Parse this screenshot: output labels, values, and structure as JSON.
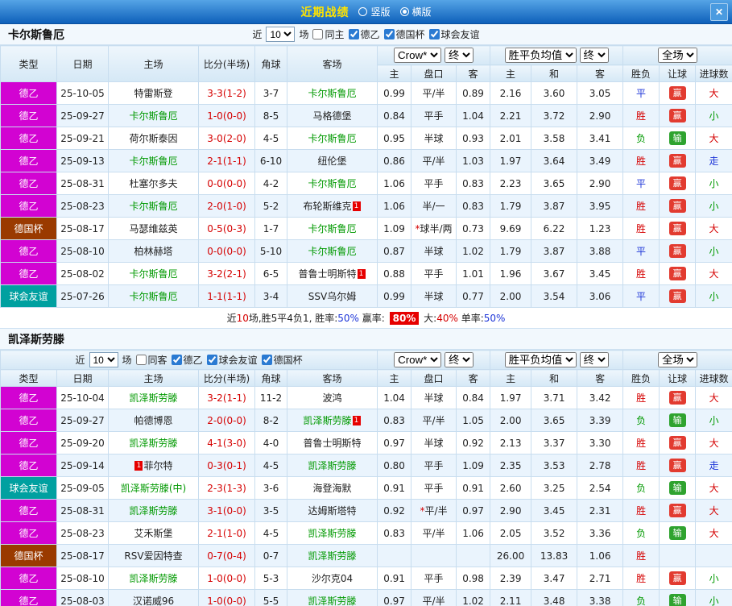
{
  "topbar": {
    "title": "近期战绩",
    "layout_options": [
      {
        "label": "竖版",
        "selected": false
      },
      {
        "label": "横版",
        "selected": true
      }
    ],
    "close_label": "✕"
  },
  "filter_near": "近",
  "filter_games": "场",
  "dropdowns": {
    "count": "10",
    "bookmaker": "Crow*",
    "time": "终",
    "avg": "胜平负均值",
    "scope": "全场"
  },
  "columns": {
    "type": "类型",
    "date": "日期",
    "home": "主场",
    "score": "比分(半场)",
    "corner": "角球",
    "away": "客场",
    "odds_home": "主",
    "odds_line": "盘口",
    "odds_away": "客",
    "eu_home": "主",
    "eu_draw": "和",
    "eu_away": "客",
    "result": "胜负",
    "handicap": "让球",
    "goals": "进球数"
  },
  "sections": [
    {
      "team": "卡尔斯鲁厄",
      "filters": [
        {
          "label": "同主",
          "checked": false
        },
        {
          "label": "德乙",
          "checked": true
        },
        {
          "label": "德国杯",
          "checked": true
        },
        {
          "label": "球会友谊",
          "checked": true
        }
      ],
      "rows": [
        {
          "type": "德乙",
          "date": "25-10-05",
          "home": {
            "name": "特雷斯登"
          },
          "score": "3-3(1-2)",
          "corner": "3-7",
          "away": {
            "name": "卡尔斯鲁厄",
            "featured": true
          },
          "o1": "0.99",
          "line": "平/半",
          "o2": "0.89",
          "w": "2.16",
          "d": "3.60",
          "l": "3.05",
          "res": "平",
          "bet": "赢",
          "goal": "大"
        },
        {
          "type": "德乙",
          "date": "25-09-27",
          "home": {
            "name": "卡尔斯鲁厄",
            "featured": true
          },
          "score": "1-0(0-0)",
          "corner": "8-5",
          "away": {
            "name": "马格德堡"
          },
          "o1": "0.84",
          "line": "平手",
          "o2": "1.04",
          "w": "2.21",
          "d": "3.72",
          "l": "2.90",
          "res": "胜",
          "bet": "赢",
          "goal": "小"
        },
        {
          "type": "德乙",
          "date": "25-09-21",
          "home": {
            "name": "荷尔斯泰因"
          },
          "score": "3-0(2-0)",
          "corner": "4-5",
          "away": {
            "name": "卡尔斯鲁厄",
            "featured": true
          },
          "o1": "0.95",
          "line": "半球",
          "o2": "0.93",
          "w": "2.01",
          "d": "3.58",
          "l": "3.41",
          "res": "负",
          "bet": "输",
          "goal": "大"
        },
        {
          "type": "德乙",
          "date": "25-09-13",
          "home": {
            "name": "卡尔斯鲁厄",
            "featured": true
          },
          "score": "2-1(1-1)",
          "corner": "6-10",
          "away": {
            "name": "纽伦堡"
          },
          "o1": "0.86",
          "line": "平/半",
          "o2": "1.03",
          "w": "1.97",
          "d": "3.64",
          "l": "3.49",
          "res": "胜",
          "bet": "赢",
          "goal": "走"
        },
        {
          "type": "德乙",
          "date": "25-08-31",
          "home": {
            "name": "杜塞尔多夫"
          },
          "score": "0-0(0-0)",
          "corner": "4-2",
          "away": {
            "name": "卡尔斯鲁厄",
            "featured": true
          },
          "o1": "1.06",
          "line": "平手",
          "o2": "0.83",
          "w": "2.23",
          "d": "3.65",
          "l": "2.90",
          "res": "平",
          "bet": "赢",
          "goal": "小"
        },
        {
          "type": "德乙",
          "date": "25-08-23",
          "home": {
            "name": "卡尔斯鲁厄",
            "featured": true
          },
          "score": "2-0(1-0)",
          "corner": "5-2",
          "away": {
            "name": "布轮斯维克",
            "badge": "1"
          },
          "o1": "1.06",
          "line": "半/一",
          "o2": "0.83",
          "w": "1.79",
          "d": "3.87",
          "l": "3.95",
          "res": "胜",
          "bet": "赢",
          "goal": "小"
        },
        {
          "type": "德国杯",
          "date": "25-08-17",
          "home": {
            "name": "马瑟维兹英"
          },
          "score": "0-5(0-3)",
          "corner": "1-7",
          "away": {
            "name": "卡尔斯鲁厄",
            "featured": true
          },
          "o1": "1.09",
          "line": "*球半/两",
          "o2": "0.73",
          "w": "9.69",
          "d": "6.22",
          "l": "1.23",
          "res": "胜",
          "bet": "赢",
          "goal": "大"
        },
        {
          "type": "德乙",
          "date": "25-08-10",
          "home": {
            "name": "柏林赫塔"
          },
          "score": "0-0(0-0)",
          "corner": "5-10",
          "away": {
            "name": "卡尔斯鲁厄",
            "featured": true
          },
          "o1": "0.87",
          "line": "半球",
          "o2": "1.02",
          "w": "1.79",
          "d": "3.87",
          "l": "3.88",
          "res": "平",
          "bet": "赢",
          "goal": "小"
        },
        {
          "type": "德乙",
          "date": "25-08-02",
          "home": {
            "name": "卡尔斯鲁厄",
            "featured": true
          },
          "score": "3-2(2-1)",
          "corner": "6-5",
          "away": {
            "name": "普鲁士明斯特",
            "badge": "1"
          },
          "o1": "0.88",
          "line": "平手",
          "o2": "1.01",
          "w": "1.96",
          "d": "3.67",
          "l": "3.45",
          "res": "胜",
          "bet": "赢",
          "goal": "大"
        },
        {
          "type": "球会友谊",
          "date": "25-07-26",
          "home": {
            "name": "卡尔斯鲁厄",
            "featured": true
          },
          "score": "1-1(1-1)",
          "corner": "3-4",
          "away": {
            "name": "SSV乌尔姆"
          },
          "o1": "0.99",
          "line": "半球",
          "o2": "0.77",
          "w": "2.00",
          "d": "3.54",
          "l": "3.06",
          "res": "平",
          "bet": "赢",
          "goal": "小"
        }
      ],
      "summary_parts": [
        {
          "t": "近",
          "s": ""
        },
        {
          "t": "10",
          "s": "red"
        },
        {
          "t": "场,胜5平4负1, 胜率:",
          "s": ""
        },
        {
          "t": "50%",
          "s": "blue"
        },
        {
          "t": " 赢率: ",
          "s": ""
        },
        {
          "t": "80%",
          "s": "badge"
        },
        {
          "t": " 大:",
          "s": ""
        },
        {
          "t": "40%",
          "s": "red"
        },
        {
          "t": " 单率:",
          "s": ""
        },
        {
          "t": "50%",
          "s": "blue"
        }
      ]
    },
    {
      "team": "凯泽斯劳滕",
      "filters": [
        {
          "label": "同客",
          "checked": false
        },
        {
          "label": "德乙",
          "checked": true
        },
        {
          "label": "球会友谊",
          "checked": true
        },
        {
          "label": "德国杯",
          "checked": true
        }
      ],
      "rows": [
        {
          "type": "德乙",
          "date": "25-10-04",
          "home": {
            "name": "凯泽斯劳滕",
            "featured": true
          },
          "score": "3-2(1-1)",
          "corner": "11-2",
          "away": {
            "name": "波鸿"
          },
          "o1": "1.04",
          "line": "半球",
          "o2": "0.84",
          "w": "1.97",
          "d": "3.71",
          "l": "3.42",
          "res": "胜",
          "bet": "赢",
          "goal": "大"
        },
        {
          "type": "德乙",
          "date": "25-09-27",
          "home": {
            "name": "帕德博恩"
          },
          "score": "2-0(0-0)",
          "corner": "8-2",
          "away": {
            "name": "凯泽斯劳滕",
            "featured": true,
            "badge": "1"
          },
          "o1": "0.83",
          "line": "平/半",
          "o2": "1.05",
          "w": "2.00",
          "d": "3.65",
          "l": "3.39",
          "res": "负",
          "bet": "输",
          "goal": "小"
        },
        {
          "type": "德乙",
          "date": "25-09-20",
          "home": {
            "name": "凯泽斯劳滕",
            "featured": true
          },
          "score": "4-1(3-0)",
          "corner": "4-0",
          "away": {
            "name": "普鲁士明斯特"
          },
          "o1": "0.97",
          "line": "半球",
          "o2": "0.92",
          "w": "2.13",
          "d": "3.37",
          "l": "3.30",
          "res": "胜",
          "bet": "赢",
          "goal": "大"
        },
        {
          "type": "德乙",
          "date": "25-09-14",
          "home": {
            "name": "菲尔特",
            "badge": "1",
            "badge_before": true
          },
          "score": "0-3(0-1)",
          "corner": "4-5",
          "away": {
            "name": "凯泽斯劳滕",
            "featured": true
          },
          "o1": "0.80",
          "line": "平手",
          "o2": "1.09",
          "w": "2.35",
          "d": "3.53",
          "l": "2.78",
          "res": "胜",
          "bet": "赢",
          "goal": "走"
        },
        {
          "type": "球会友谊",
          "date": "25-09-05",
          "home": {
            "name": "凯泽斯劳滕(中)",
            "featured": true
          },
          "score": "2-3(1-3)",
          "corner": "3-6",
          "away": {
            "name": "海登海默"
          },
          "o1": "0.91",
          "line": "平手",
          "o2": "0.91",
          "w": "2.60",
          "d": "3.25",
          "l": "2.54",
          "res": "负",
          "bet": "输",
          "goal": "大"
        },
        {
          "type": "德乙",
          "date": "25-08-31",
          "home": {
            "name": "凯泽斯劳滕",
            "featured": true
          },
          "score": "3-1(0-0)",
          "corner": "3-5",
          "away": {
            "name": "达姆斯塔特"
          },
          "o1": "0.92",
          "line": "*平/半",
          "o2": "0.97",
          "w": "2.90",
          "d": "3.45",
          "l": "2.31",
          "res": "胜",
          "bet": "赢",
          "goal": "大"
        },
        {
          "type": "德乙",
          "date": "25-08-23",
          "home": {
            "name": "艾禾斯堡"
          },
          "score": "2-1(1-0)",
          "corner": "4-5",
          "away": {
            "name": "凯泽斯劳滕",
            "featured": true
          },
          "o1": "0.83",
          "line": "平/半",
          "o2": "1.06",
          "w": "2.05",
          "d": "3.52",
          "l": "3.36",
          "res": "负",
          "bet": "输",
          "goal": "大"
        },
        {
          "type": "德国杯",
          "date": "25-08-17",
          "home": {
            "name": "RSV爱因特查"
          },
          "score": "0-7(0-4)",
          "corner": "0-7",
          "away": {
            "name": "凯泽斯劳滕",
            "featured": true
          },
          "o1": "",
          "line": "",
          "o2": "",
          "w": "26.00",
          "d": "13.83",
          "l": "1.06",
          "res": "胜",
          "bet": "",
          "goal": ""
        },
        {
          "type": "德乙",
          "date": "25-08-10",
          "home": {
            "name": "凯泽斯劳滕",
            "featured": true
          },
          "score": "1-0(0-0)",
          "corner": "5-3",
          "away": {
            "name": "沙尔克04"
          },
          "o1": "0.91",
          "line": "平手",
          "o2": "0.98",
          "w": "2.39",
          "d": "3.47",
          "l": "2.71",
          "res": "胜",
          "bet": "赢",
          "goal": "小"
        },
        {
          "type": "德乙",
          "date": "25-08-03",
          "home": {
            "name": "汉诺威96"
          },
          "score": "1-0(0-0)",
          "corner": "5-5",
          "away": {
            "name": "凯泽斯劳滕",
            "featured": true
          },
          "o1": "0.97",
          "line": "平/半",
          "o2": "1.02",
          "w": "2.11",
          "d": "3.48",
          "l": "3.38",
          "res": "负",
          "bet": "输",
          "goal": "小"
        }
      ]
    }
  ]
}
